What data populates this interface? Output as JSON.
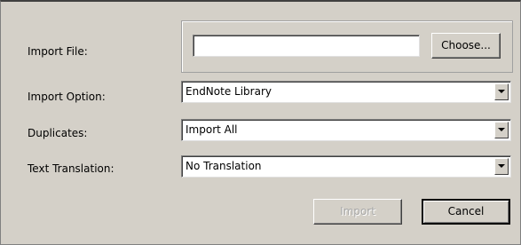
{
  "form": {
    "import_file": {
      "label": "Import File:",
      "value": "",
      "choose_label": "Choose..."
    },
    "import_option": {
      "label": "Import Option:",
      "value": "EndNote Library"
    },
    "duplicates": {
      "label": "Duplicates:",
      "value": "Import All"
    },
    "text_translation": {
      "label": "Text Translation:",
      "value": "No Translation"
    }
  },
  "buttons": {
    "import_label": "Import",
    "cancel_label": "Cancel"
  },
  "icons": {
    "dropdown": "chevron-down-icon"
  }
}
